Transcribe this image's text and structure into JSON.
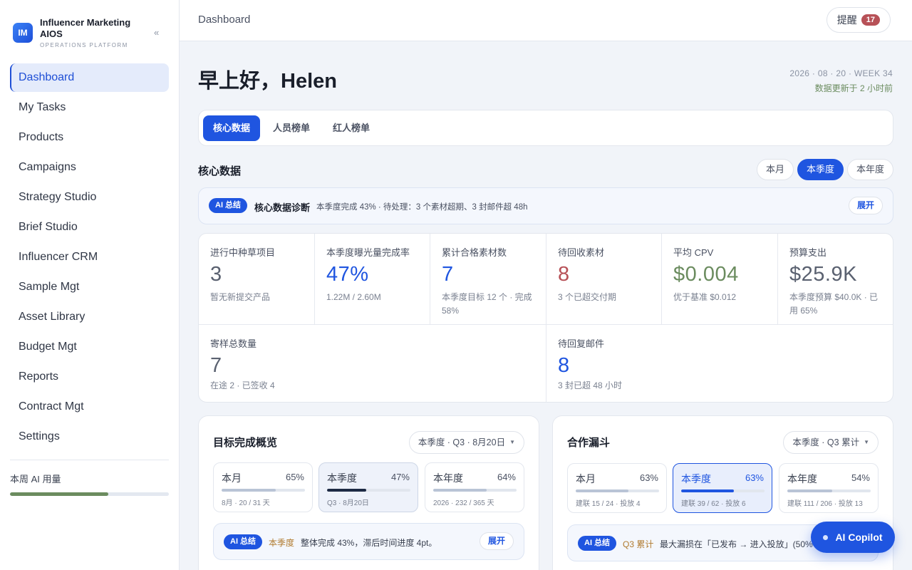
{
  "brand": {
    "logo": "IM",
    "name": "Influencer Marketing AIOS",
    "subtitle": "OPERATIONS PLATFORM",
    "collapse_icon": "«"
  },
  "sidebar": {
    "items": [
      {
        "label": "Dashboard",
        "active": true
      },
      {
        "label": "My Tasks"
      },
      {
        "label": "Products"
      },
      {
        "label": "Campaigns"
      },
      {
        "label": "Strategy Studio"
      },
      {
        "label": "Brief Studio"
      },
      {
        "label": "Influencer CRM"
      },
      {
        "label": "Sample Mgt"
      },
      {
        "label": "Asset Library"
      },
      {
        "label": "Budget Mgt"
      },
      {
        "label": "Reports"
      },
      {
        "label": "Contract Mgt"
      },
      {
        "label": "Settings"
      }
    ],
    "ai_usage_label": "本周 AI 用量",
    "ai_usage_fraction": 0.62
  },
  "topbar": {
    "breadcrumb": "Dashboard",
    "remind_label": "提醒",
    "remind_count": "17"
  },
  "header": {
    "greeting": "早上好，Helen",
    "date": "2026 · 08 · 20 · WEEK 34",
    "updated": "数据更新于 2 小时前"
  },
  "tabs": [
    "核心数据",
    "人员榜单",
    "红人榜单"
  ],
  "core": {
    "title": "核心数据",
    "periods": [
      "本月",
      "本季度",
      "本年度"
    ],
    "ai": {
      "badge": "AI 总结",
      "title": "核心数据诊断",
      "text": "本季度完成 43% · 待处理：3 个素材超期、3 封邮件超 48h",
      "expand": "展开"
    },
    "kpis": [
      {
        "label": "进行中种草项目",
        "value": "3",
        "sub": "暂无新提交产品"
      },
      {
        "label": "本季度曝光量完成率",
        "value": "47%",
        "sub": "1.22M / 2.60M"
      },
      {
        "label": "累计合格素材数",
        "value": "7",
        "sub": "本季度目标 12 个 · 完成 58%"
      },
      {
        "label": "待回收素材",
        "value": "8",
        "sub": "3 个已超交付期"
      },
      {
        "label": "平均 CPV",
        "value": "$0.004",
        "sub": "优于基准 $0.012"
      },
      {
        "label": "预算支出",
        "value": "$25.9K",
        "sub": "本季度预算 $40.0K · 已用 65%"
      },
      {
        "label": "寄样总数量",
        "value": "7",
        "sub": "在途 2 · 已签收 4"
      },
      {
        "label": "待回复邮件",
        "value": "8",
        "sub": "3 封已超 48 小时"
      }
    ]
  },
  "goals": {
    "title": "目标完成概览",
    "select": "本季度 · Q3 · 8月20日",
    "cards": [
      {
        "label": "本月",
        "pct": "65%",
        "fraction": 0.65,
        "sub": "8月 · 20 / 31 天"
      },
      {
        "label": "本季度",
        "pct": "47%",
        "fraction": 0.47,
        "sub": "Q3 · 8月20日"
      },
      {
        "label": "本年度",
        "pct": "64%",
        "fraction": 0.64,
        "sub": "2026 · 232 / 365 天"
      }
    ],
    "ai": {
      "badge": "AI 总结",
      "period": "本季度",
      "text": "整体完成 43%，滞后时间进度 4pt。",
      "expand": "展开"
    }
  },
  "funnel": {
    "title": "合作漏斗",
    "select": "本季度 · Q3 累计",
    "cards": [
      {
        "label": "本月",
        "pct": "63%",
        "fraction": 0.63,
        "sub": "建联 15 / 24 · 投放 4"
      },
      {
        "label": "本季度",
        "pct": "63%",
        "fraction": 0.63,
        "sub": "建联 39 / 62 · 投放 6"
      },
      {
        "label": "本年度",
        "pct": "54%",
        "fraction": 0.54,
        "sub": "建联 111 / 206 · 投放 13"
      }
    ],
    "ai": {
      "badge": "AI 总结",
      "period": "Q3 累计",
      "text": "最大漏损在「已发布 → 进入投放」(50%"
    }
  },
  "copilot": {
    "label": "AI Copilot"
  },
  "colors": {
    "accent": "#1f55e0",
    "danger": "#b75157",
    "success": "#6b8c5f"
  }
}
